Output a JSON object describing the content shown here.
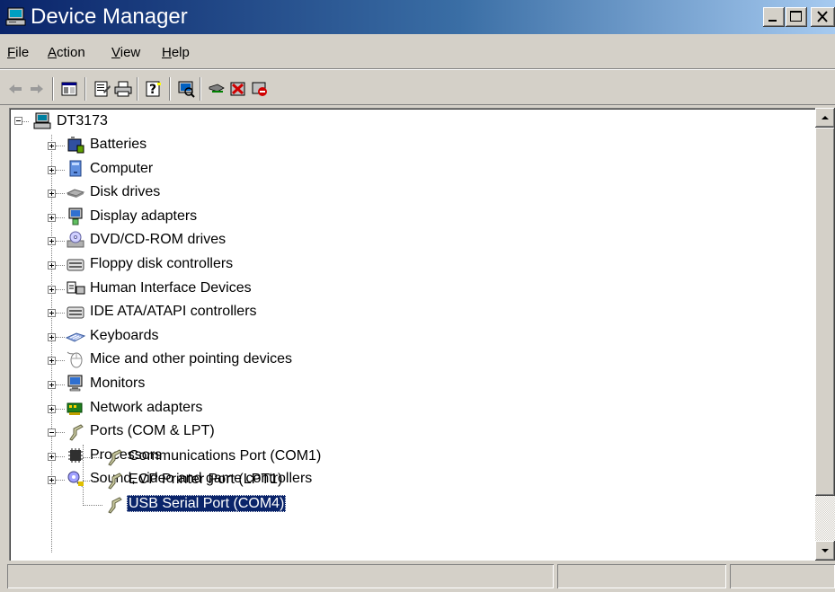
{
  "window": {
    "title": "Device Manager",
    "icon": "computer-icon"
  },
  "menu": {
    "items": [
      {
        "label": "File",
        "accel": "F",
        "rest": "ile"
      },
      {
        "label": "Action",
        "accel": "A",
        "rest": "ction"
      },
      {
        "label": "View",
        "accel": "V",
        "rest": "iew"
      },
      {
        "label": "Help",
        "accel": "H",
        "rest": "elp"
      }
    ]
  },
  "toolbar": {
    "buttons": [
      "back-arrow-icon",
      "forward-arrow-icon",
      "show-hide-console-tree-icon",
      "properties-icon",
      "print-icon",
      "help-icon",
      "scan-hardware-icon",
      "update-driver-icon",
      "uninstall-icon",
      "disable-icon"
    ]
  },
  "tree": {
    "root": {
      "label": "DT3173",
      "icon": "computer-icon",
      "expanded": true
    },
    "categories": [
      {
        "label": "Batteries",
        "icon": "battery-icon",
        "expanded": false
      },
      {
        "label": "Computer",
        "icon": "computer-icon",
        "expanded": false
      },
      {
        "label": "Disk drives",
        "icon": "disk-drive-icon",
        "expanded": false
      },
      {
        "label": "Display adapters",
        "icon": "display-adapter-icon",
        "expanded": false
      },
      {
        "label": "DVD/CD-ROM drives",
        "icon": "cdrom-icon",
        "expanded": false
      },
      {
        "label": "Floppy disk controllers",
        "icon": "controller-icon",
        "expanded": false
      },
      {
        "label": "Human Interface Devices",
        "icon": "hid-icon",
        "expanded": false
      },
      {
        "label": "IDE ATA/ATAPI controllers",
        "icon": "controller-icon",
        "expanded": false
      },
      {
        "label": "Keyboards",
        "icon": "keyboard-icon",
        "expanded": false
      },
      {
        "label": "Mice and other pointing devices",
        "icon": "mouse-icon",
        "expanded": false
      },
      {
        "label": "Monitors",
        "icon": "monitor-icon",
        "expanded": false
      },
      {
        "label": "Network adapters",
        "icon": "network-adapter-icon",
        "expanded": false
      },
      {
        "label": "Ports (COM & LPT)",
        "icon": "port-icon",
        "expanded": true,
        "children": [
          {
            "label": "Communications Port (COM1)",
            "icon": "port-icon",
            "selected": false
          },
          {
            "label": "ECP Printer Port (LPT1)",
            "icon": "port-icon",
            "selected": false
          },
          {
            "label": "USB Serial Port (COM4)",
            "icon": "port-icon",
            "selected": true
          }
        ]
      },
      {
        "label": "Processors",
        "icon": "processor-icon",
        "expanded": false
      },
      {
        "label": "Sound, video and game controllers",
        "icon": "sound-icon",
        "expanded": false
      }
    ]
  },
  "statusbar": {
    "panes": [
      "",
      "",
      ""
    ]
  },
  "colors": {
    "titlebar_start": "#0a246a",
    "titlebar_end": "#a6caf0",
    "selection": "#0a246a",
    "chrome": "#d4d0c8"
  }
}
